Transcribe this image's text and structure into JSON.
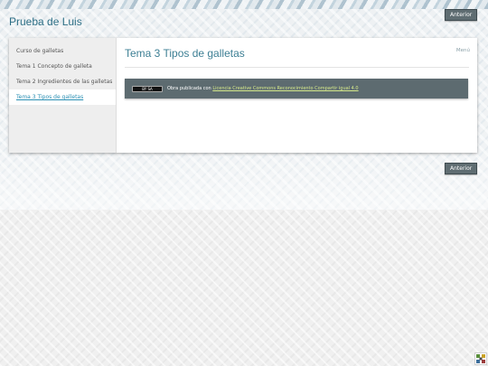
{
  "site": {
    "title": "Prueba de Luis"
  },
  "nav": {
    "prev_label_top": "Anterior",
    "prev_label_bottom": "Anterior"
  },
  "sidebar": {
    "items": [
      {
        "label": "Curso de galletas"
      },
      {
        "label": "Tema 1 Concepto de galleta"
      },
      {
        "label": "Tema 2 Ingredientes de las galletas"
      },
      {
        "label": "Tema 3 Tipos de galletas"
      }
    ]
  },
  "main": {
    "menu_link": "Menú",
    "heading": "Tema 3 Tipos de galletas",
    "license": {
      "badge_text": "BY SA",
      "prefix": "Obra publicada con ",
      "link_text": "Licencia Creative Commons Reconocimiento Compartir igual 4.0"
    }
  },
  "colors": {
    "accent": "#2d6f86",
    "active_link": "#2a8fb3",
    "license_bar": "#5d6b70",
    "license_link": "#d5e98a"
  },
  "icons": {
    "corner": "puzzle-icon"
  }
}
